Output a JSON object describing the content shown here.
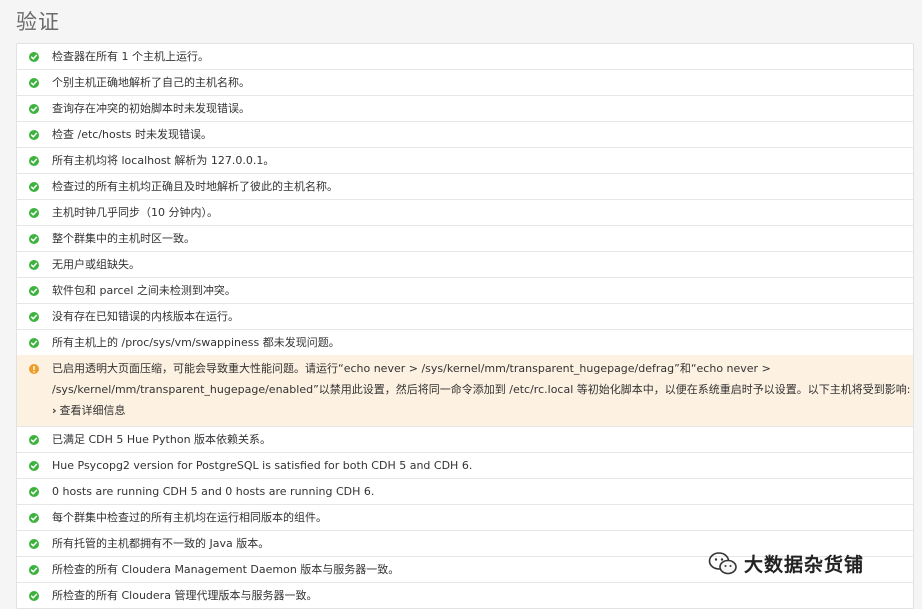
{
  "page": {
    "title": "验证"
  },
  "checks_before": [
    "检查器在所有 1 个主机上运行。",
    "个别主机正确地解析了自己的主机名称。",
    "查询存在冲突的初始脚本时未发现错误。",
    "检查 /etc/hosts 时未发现错误。",
    "所有主机均将 localhost 解析为 127.0.0.1。",
    "检查过的所有主机均正确且及时地解析了彼此的主机名称。",
    "主机时钟几乎同步（10 分钟内）。",
    "整个群集中的主机时区一致。",
    "无用户或组缺失。",
    "软件包和 parcel 之间未检测到冲突。",
    "没有存在已知错误的内核版本在运行。",
    "所有主机上的 /proc/sys/vm/swappiness 都未发现问题。"
  ],
  "warning": {
    "line1": "已启用透明大页面压缩，可能会导致重大性能问题。请运行“echo never > /sys/kernel/mm/transparent_hugepage/defrag”和“echo never >",
    "line2": "/sys/kernel/mm/transparent_hugepage/enabled”以禁用此设置，然后将同一命令添加到 /etc/rc.local 等初始化脚本中，以便在系统重启时予以设置。以下主机将受到影响:",
    "details_label": "查看详细信息"
  },
  "checks_after": [
    "已满足 CDH 5 Hue Python 版本依赖关系。",
    "Hue Psycopg2 version for PostgreSQL is satisfied for both CDH 5 and CDH 6.",
    "0 hosts are running CDH 5 and 0 hosts are running CDH 6.",
    "每个群集中检查过的所有主机均在运行相同版本的组件。",
    "所有托管的主机都拥有不一致的 Java 版本。",
    "所检查的所有 Cloudera Management Daemon 版本与服务器一致。",
    "所检查的所有 Cloudera 管理代理版本与服务器一致。"
  ],
  "watermark": {
    "text": "大数据杂货铺"
  },
  "colors": {
    "ok": "#3db23d",
    "warn": "#ef9d2a",
    "warning_bg": "#fdf1e2"
  },
  "icons": {
    "ok": "check-circle-icon",
    "warn": "exclamation-circle-icon",
    "details": "chevron-right-icon",
    "watermark": "wechat-icon"
  }
}
